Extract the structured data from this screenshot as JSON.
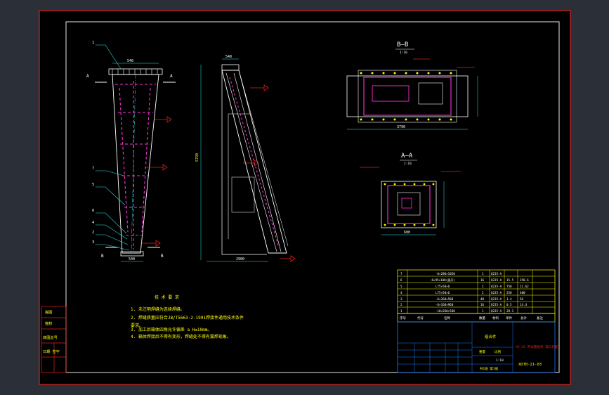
{
  "colors": {
    "viewport_bg": "#2b2f38",
    "sheet_bg": "#000000",
    "border_red": "#e0201c",
    "line_white": "#ffffff",
    "accent_magenta": "#ff2fd6",
    "accent_yellow": "#ffff00",
    "accent_cyan": "#2fe6e6",
    "hatch_blue": "#1b7cff"
  },
  "sections": {
    "bb_title": "B—B",
    "bb_scale": "1:10",
    "aa_title": "A—A",
    "aa_scale": "1:10"
  },
  "cut_labels": {
    "a_left": "A",
    "a_right": "A",
    "b_left": "B",
    "b_right": "B"
  },
  "dimensions": {
    "top_width": "540",
    "bottom_width": "540",
    "side_top": "540",
    "side_bottom": "2900",
    "height_total": "6790",
    "bb_width": "1000",
    "bb_total": "3790",
    "aa_width": "600"
  },
  "balloons": [
    "1",
    "2",
    "3",
    "4",
    "5",
    "6",
    "7"
  ],
  "notes": {
    "heading": "技 术 要 求",
    "lines": [
      "1. 未注明焊缝为连续焊缝。",
      "2. 焊缝质量应符合JB/T5663·2-1991焊接件通用技术条件",
      "   要求。",
      "3. 加工后箱体四角允许偏差 a H≤10mm。",
      "4. 箱体焊接后不得有变形，焊缝处不得有漏焊现象。"
    ]
  },
  "left_stamp": [
    "描图",
    "描校",
    "底图总号",
    "日期 签字"
  ],
  "bom": {
    "rows": [
      [
        "7",
        "-6×280×1050",
        "1",
        "Q235-A",
        "",
        ""
      ],
      [
        "6",
        "-6×95×100(展开)",
        "16",
        "Q235-A",
        "15.5",
        "250.6"
      ],
      [
        "5",
        "L75×50×6",
        "2",
        "Q235-A",
        "750",
        "11.62"
      ],
      [
        "4",
        "L75×50×6",
        "2",
        "Q235-A",
        "250",
        "400"
      ],
      [
        "3",
        "-6×260×580",
        "40",
        "Q235-A",
        "1.4",
        "56"
      ],
      [
        "2",
        "-6×160×960",
        "16",
        "Q235-A",
        "0.5",
        "14.4"
      ],
      [
        "1",
        "-10×260×580",
        "1",
        "Q235-A",
        "28.1",
        ""
      ]
    ],
    "header": [
      "序号",
      "代号",
      "名称",
      "数量",
      "材料",
      "单件",
      "总计",
      "备注"
    ],
    "part_name": "XX-20 带式输送机 漏斗装配",
    "drawing_number": "XDTB-21-03",
    "material_label": "组合件",
    "weight_label": "重量",
    "scale_label": "比例",
    "scale_value": "1:10",
    "sheet_label": "共1张 第1张"
  }
}
